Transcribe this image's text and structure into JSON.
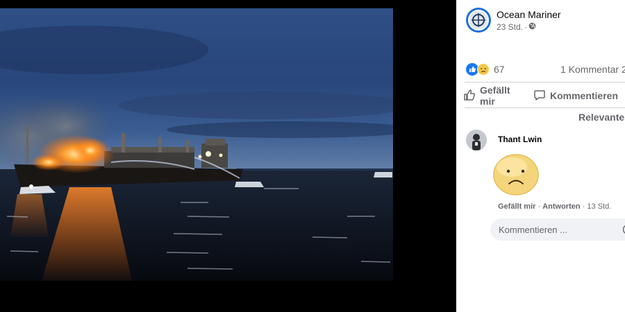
{
  "post": {
    "author": "Ocean Mariner",
    "time": "23 Std.",
    "audience_icon": "globe-icon",
    "reaction_count": "67",
    "comment_count": "1 Kommentar",
    "comment_count_overflow": "2",
    "reactions": [
      "like-icon",
      "sad-icon"
    ]
  },
  "actions": {
    "like": "Gefällt mir",
    "comment": "Kommentieren"
  },
  "comments": {
    "sort_label": "Relevanteste",
    "items": [
      {
        "author": "Thant Lwin",
        "sticker": "sad-face-sticker",
        "like_label": "Gefällt mir",
        "separator": "·",
        "reply_label": "Antworten",
        "time": "13 Std."
      }
    ]
  },
  "composer": {
    "placeholder": "Kommentieren ..."
  },
  "colors": {
    "accent": "#1877f2",
    "text_secondary": "#65676b",
    "divider": "#ced0d4",
    "input_bg": "#f0f2f5"
  }
}
